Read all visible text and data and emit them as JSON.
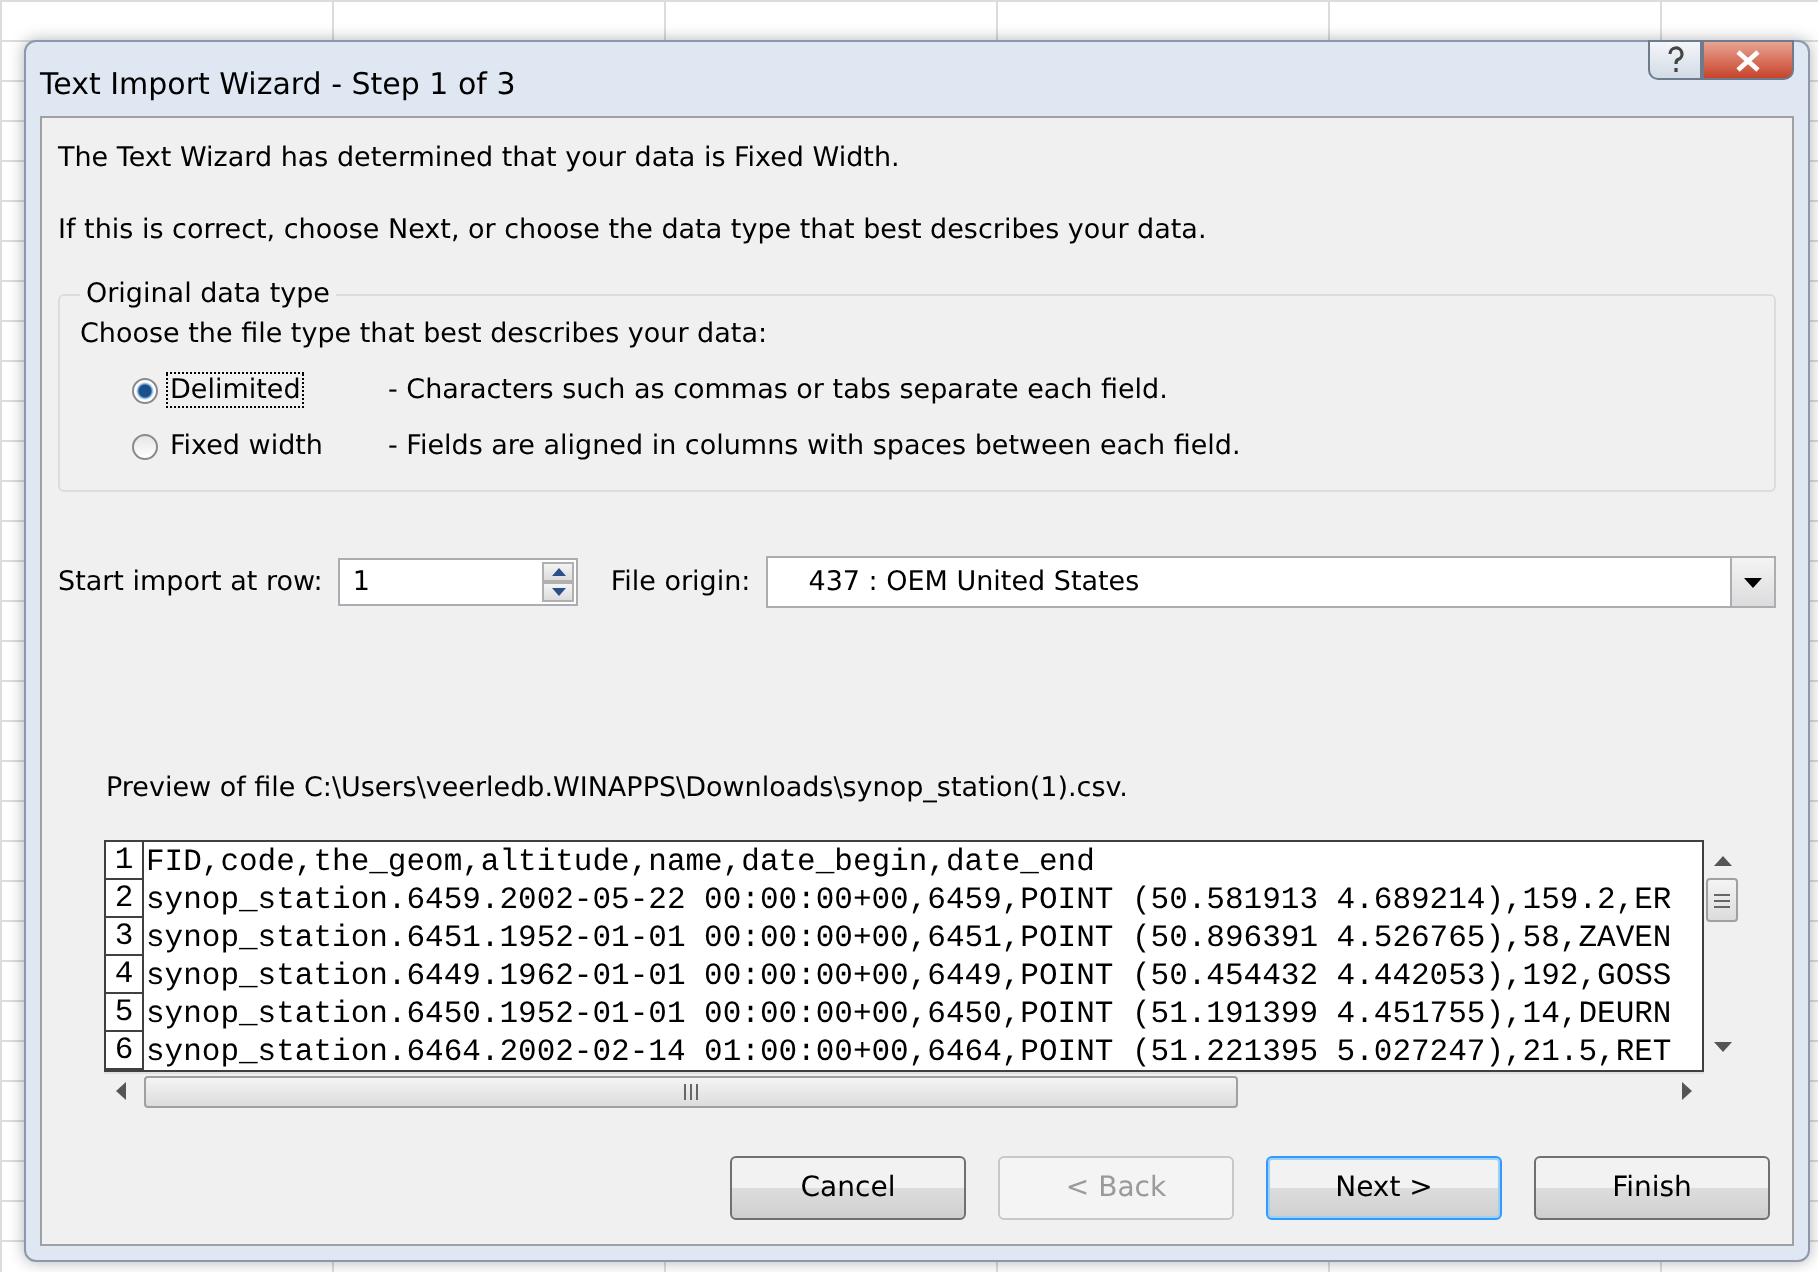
{
  "window": {
    "title": "Text Import Wizard - Step 1 of 3"
  },
  "intro": [
    "The Text Wizard has determined that your data is Fixed Width.",
    "If this is correct, choose Next, or choose the data type that best describes your data."
  ],
  "data_type_group": {
    "legend": "Original data type",
    "prompt": "Choose the file type that best describes your data:",
    "options": [
      {
        "label": "Delimited",
        "description": "- Characters such as commas or tabs separate each field.",
        "selected": true,
        "focused": true
      },
      {
        "label": "Fixed width",
        "description": "- Fields are aligned in columns with spaces between each field.",
        "selected": false,
        "focused": false
      }
    ]
  },
  "start_row": {
    "label": "Start import at row:",
    "value": "1"
  },
  "file_origin": {
    "label": "File origin:",
    "value": "437 : OEM United States"
  },
  "preview": {
    "label": "Preview of file C:\\Users\\veerledb.WINAPPS\\Downloads\\synop_station(1).csv.",
    "rows": [
      {
        "number": "1",
        "text": "FID,code,the_geom,altitude,name,date_begin,date_end"
      },
      {
        "number": "2",
        "text": "synop_station.6459.2002-05-22 00:00:00+00,6459,POINT (50.581913 4.689214),159.2,ER"
      },
      {
        "number": "3",
        "text": "synop_station.6451.1952-01-01 00:00:00+00,6451,POINT (50.896391 4.526765),58,ZAVEN"
      },
      {
        "number": "4",
        "text": "synop_station.6449.1962-01-01 00:00:00+00,6449,POINT (50.454432 4.442053),192,GOSS"
      },
      {
        "number": "5",
        "text": "synop_station.6450.1952-01-01 00:00:00+00,6450,POINT (51.191399 4.451755),14,DEURN"
      },
      {
        "number": "6",
        "text": "synop_station.6464.2002-02-14 01:00:00+00,6464,POINT (51.221395 5.027247),21.5,RET"
      }
    ]
  },
  "buttons": [
    {
      "label": "Cancel",
      "disabled": false,
      "focused": false
    },
    {
      "label": "< Back",
      "disabled": true,
      "focused": false
    },
    {
      "label": "Next >",
      "disabled": false,
      "focused": true
    },
    {
      "label": "Finish",
      "disabled": false,
      "focused": false
    }
  ]
}
